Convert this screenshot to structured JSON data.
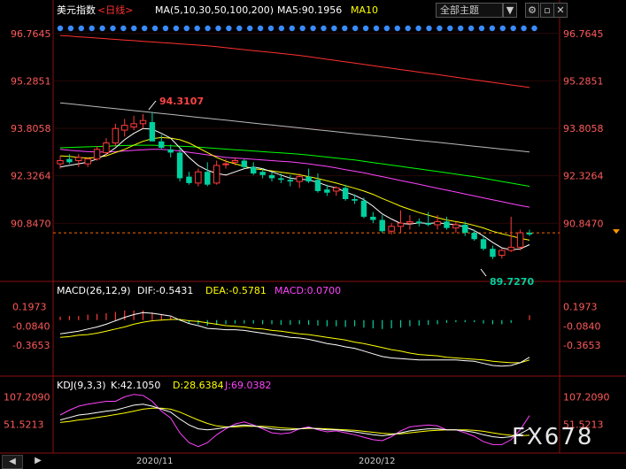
{
  "header": {
    "name": "美元指数",
    "period": "<日线>",
    "ma_label": "MA(5,10,30,50,100,200)",
    "ma5_label": "MA5:90.1956",
    "ma10_label": "MA10",
    "theme_button": "全部主题",
    "theme_arrow": "▼"
  },
  "colors": {
    "up": "#ff3b3b",
    "down": "#00d0a0",
    "price_label": "#ff4444",
    "ma5": "#ffffff",
    "ma10": "#ffff00",
    "ma30": "#ff44ff",
    "ma50": "#00ff00",
    "ma100": "#bbbbbb",
    "ma200": "#ff3030",
    "macd_dif": "#ffffff",
    "macd_dea": "#ffff00",
    "macd_bar": "#ff44ff",
    "kdj_k": "#ffffff",
    "kdj_d": "#ffff00",
    "kdj_j": "#ff44ff"
  },
  "macd_header": {
    "name": "MACD(26,12,9)",
    "dif": "DIF:-0.5431",
    "dea": "DEA:-0.5781",
    "macd": "MACD:0.0700"
  },
  "kdj_header": {
    "name": "KDJ(9,3,3)",
    "k": "K:42.1050",
    "d": "D:28.6384",
    "j": "J:69.0382"
  },
  "annotations": {
    "high": "94.3107",
    "low": "89.7270"
  },
  "watermark": "FX678",
  "footer": {
    "x_ticks": [
      "2020/11",
      "2020/12"
    ]
  },
  "chart_data": {
    "type": "candlestick",
    "price_axis_ticks": [
      "96.7645",
      "95.2851",
      "93.8058",
      "92.3264",
      "90.8470"
    ],
    "macd_axis_ticks": [
      "0.1973",
      "-0.0840",
      "-0.3653"
    ],
    "kdj_axis_ticks": [
      "107.2090",
      "51.5213"
    ],
    "ylim_price": [
      89.2,
      97.2
    ],
    "last_price_line": 90.55,
    "candles": [
      {
        "o": 92.7,
        "h": 92.95,
        "l": 92.55,
        "c": 92.8
      },
      {
        "o": 92.85,
        "h": 93.0,
        "l": 92.7,
        "c": 92.75
      },
      {
        "o": 92.8,
        "h": 93.0,
        "l": 92.6,
        "c": 92.9
      },
      {
        "o": 92.7,
        "h": 92.9,
        "l": 92.6,
        "c": 92.85
      },
      {
        "o": 92.85,
        "h": 93.25,
        "l": 92.8,
        "c": 93.15
      },
      {
        "o": 93.05,
        "h": 93.5,
        "l": 92.95,
        "c": 93.35
      },
      {
        "o": 93.35,
        "h": 93.95,
        "l": 93.25,
        "c": 93.8
      },
      {
        "o": 93.75,
        "h": 94.1,
        "l": 93.55,
        "c": 93.9
      },
      {
        "o": 93.85,
        "h": 94.2,
        "l": 93.75,
        "c": 93.95
      },
      {
        "o": 93.95,
        "h": 94.25,
        "l": 93.8,
        "c": 94.05
      },
      {
        "o": 94.0,
        "h": 94.31,
        "l": 93.7,
        "c": 93.4
      },
      {
        "o": 93.4,
        "h": 93.6,
        "l": 93.15,
        "c": 93.2
      },
      {
        "o": 93.15,
        "h": 93.3,
        "l": 92.9,
        "c": 93.05
      },
      {
        "o": 93.05,
        "h": 93.2,
        "l": 92.15,
        "c": 92.25
      },
      {
        "o": 92.3,
        "h": 92.45,
        "l": 92.05,
        "c": 92.1
      },
      {
        "o": 92.1,
        "h": 92.55,
        "l": 92.0,
        "c": 92.45
      },
      {
        "o": 92.45,
        "h": 92.75,
        "l": 92.0,
        "c": 92.05
      },
      {
        "o": 92.1,
        "h": 92.8,
        "l": 92.05,
        "c": 92.65
      },
      {
        "o": 92.7,
        "h": 92.85,
        "l": 92.55,
        "c": 92.7
      },
      {
        "o": 92.75,
        "h": 92.9,
        "l": 92.65,
        "c": 92.8
      },
      {
        "o": 92.8,
        "h": 92.85,
        "l": 92.55,
        "c": 92.6
      },
      {
        "o": 92.6,
        "h": 92.75,
        "l": 92.35,
        "c": 92.4
      },
      {
        "o": 92.45,
        "h": 92.55,
        "l": 92.25,
        "c": 92.35
      },
      {
        "o": 92.35,
        "h": 92.45,
        "l": 92.15,
        "c": 92.25
      },
      {
        "o": 92.25,
        "h": 92.4,
        "l": 92.1,
        "c": 92.2
      },
      {
        "o": 92.2,
        "h": 92.35,
        "l": 92.0,
        "c": 92.15
      },
      {
        "o": 92.15,
        "h": 92.4,
        "l": 91.95,
        "c": 92.3
      },
      {
        "o": 92.3,
        "h": 92.55,
        "l": 92.1,
        "c": 92.15
      },
      {
        "o": 92.2,
        "h": 92.4,
        "l": 91.8,
        "c": 91.85
      },
      {
        "o": 91.9,
        "h": 92.05,
        "l": 91.7,
        "c": 91.8
      },
      {
        "o": 91.85,
        "h": 92.0,
        "l": 91.7,
        "c": 91.95
      },
      {
        "o": 91.95,
        "h": 92.05,
        "l": 91.55,
        "c": 91.6
      },
      {
        "o": 91.6,
        "h": 91.75,
        "l": 91.45,
        "c": 91.55
      },
      {
        "o": 91.55,
        "h": 91.65,
        "l": 91.0,
        "c": 91.05
      },
      {
        "o": 91.05,
        "h": 91.2,
        "l": 90.85,
        "c": 90.95
      },
      {
        "o": 90.95,
        "h": 91.1,
        "l": 90.55,
        "c": 90.6
      },
      {
        "o": 90.6,
        "h": 90.85,
        "l": 90.5,
        "c": 90.75
      },
      {
        "o": 90.75,
        "h": 91.25,
        "l": 90.55,
        "c": 90.85
      },
      {
        "o": 90.85,
        "h": 91.1,
        "l": 90.65,
        "c": 90.9
      },
      {
        "o": 90.9,
        "h": 91.0,
        "l": 90.75,
        "c": 90.85
      },
      {
        "o": 90.85,
        "h": 91.2,
        "l": 90.75,
        "c": 90.8
      },
      {
        "o": 90.8,
        "h": 91.1,
        "l": 90.65,
        "c": 90.9
      },
      {
        "o": 90.9,
        "h": 91.05,
        "l": 90.65,
        "c": 90.7
      },
      {
        "o": 90.7,
        "h": 90.9,
        "l": 90.55,
        "c": 90.8
      },
      {
        "o": 90.8,
        "h": 90.9,
        "l": 90.45,
        "c": 90.55
      },
      {
        "o": 90.55,
        "h": 90.65,
        "l": 90.3,
        "c": 90.35
      },
      {
        "o": 90.35,
        "h": 90.45,
        "l": 90.0,
        "c": 90.05
      },
      {
        "o": 90.05,
        "h": 90.15,
        "l": 89.73,
        "c": 89.8
      },
      {
        "o": 89.85,
        "h": 90.05,
        "l": 89.75,
        "c": 90.0
      },
      {
        "o": 90.0,
        "h": 91.05,
        "l": 89.95,
        "c": 90.1
      },
      {
        "o": 90.1,
        "h": 90.65,
        "l": 90.0,
        "c": 90.55
      },
      {
        "o": 90.55,
        "h": 90.65,
        "l": 90.45,
        "c": 90.5
      }
    ],
    "ma5": [
      92.6,
      92.65,
      92.7,
      92.75,
      92.85,
      93.0,
      93.2,
      93.45,
      93.65,
      93.8,
      93.78,
      93.65,
      93.5,
      93.2,
      92.9,
      92.65,
      92.5,
      92.4,
      92.35,
      92.45,
      92.55,
      92.6,
      92.55,
      92.45,
      92.35,
      92.25,
      92.22,
      92.2,
      92.12,
      92.02,
      91.95,
      91.82,
      91.72,
      91.58,
      91.38,
      91.14,
      90.98,
      90.84,
      90.82,
      90.86,
      90.84,
      90.86,
      90.83,
      90.8,
      90.73,
      90.62,
      90.45,
      90.25,
      90.08,
      90.02,
      90.05,
      90.18
    ],
    "ma10": [
      92.95,
      92.93,
      92.9,
      92.88,
      92.9,
      92.95,
      93.05,
      93.15,
      93.28,
      93.4,
      93.48,
      93.52,
      93.5,
      93.45,
      93.35,
      93.2,
      93.05,
      92.9,
      92.78,
      92.7,
      92.62,
      92.55,
      92.52,
      92.48,
      92.44,
      92.4,
      92.36,
      92.3,
      92.24,
      92.17,
      92.1,
      92.02,
      91.94,
      91.85,
      91.75,
      91.62,
      91.5,
      91.38,
      91.28,
      91.18,
      91.1,
      91.02,
      90.95,
      90.9,
      90.85,
      90.78,
      90.7,
      90.6,
      90.52,
      90.45,
      90.38,
      90.32
    ],
    "ma30": [
      93.15,
      93.12,
      93.1,
      93.08,
      93.07,
      93.07,
      93.08,
      93.1,
      93.12,
      93.14,
      93.15,
      93.15,
      93.13,
      93.1,
      93.06,
      93.02,
      92.98,
      92.94,
      92.9,
      92.88,
      92.86,
      92.84,
      92.82,
      92.8,
      92.78,
      92.76,
      92.73,
      92.7,
      92.66,
      92.62,
      92.57,
      92.52,
      92.47,
      92.42,
      92.36,
      92.3,
      92.24,
      92.18,
      92.12,
      92.06,
      92.0,
      91.94,
      91.88,
      91.82,
      91.76,
      91.7,
      91.64,
      91.58,
      91.52,
      91.46,
      91.4,
      91.35
    ],
    "ma50": [
      93.2,
      93.21,
      93.22,
      93.23,
      93.24,
      93.25,
      93.26,
      93.27,
      93.28,
      93.28,
      93.28,
      93.27,
      93.26,
      93.25,
      93.24,
      93.22,
      93.2,
      93.18,
      93.16,
      93.14,
      93.12,
      93.1,
      93.08,
      93.06,
      93.04,
      93.02,
      93.0,
      92.97,
      92.94,
      92.91,
      92.88,
      92.85,
      92.82,
      92.78,
      92.74,
      92.7,
      92.66,
      92.62,
      92.58,
      92.54,
      92.5,
      92.46,
      92.42,
      92.38,
      92.34,
      92.3,
      92.25,
      92.2,
      92.15,
      92.1,
      92.05,
      92.0
    ],
    "ma100": [
      94.6,
      94.57,
      94.54,
      94.51,
      94.48,
      94.45,
      94.42,
      94.39,
      94.36,
      94.33,
      94.3,
      94.27,
      94.24,
      94.21,
      94.18,
      94.15,
      94.12,
      94.09,
      94.06,
      94.03,
      94.0,
      93.97,
      93.94,
      93.91,
      93.88,
      93.85,
      93.82,
      93.79,
      93.76,
      93.73,
      93.7,
      93.67,
      93.64,
      93.61,
      93.58,
      93.55,
      93.52,
      93.49,
      93.46,
      93.43,
      93.4,
      93.37,
      93.34,
      93.31,
      93.28,
      93.25,
      93.22,
      93.19,
      93.16,
      93.13,
      93.1,
      93.07
    ],
    "ma200": [
      96.7,
      96.68,
      96.66,
      96.64,
      96.62,
      96.6,
      96.58,
      96.56,
      96.54,
      96.52,
      96.5,
      96.48,
      96.46,
      96.44,
      96.42,
      96.4,
      96.38,
      96.35,
      96.32,
      96.29,
      96.26,
      96.23,
      96.2,
      96.17,
      96.14,
      96.11,
      96.08,
      96.04,
      96.0,
      95.96,
      95.92,
      95.88,
      95.84,
      95.8,
      95.76,
      95.72,
      95.68,
      95.64,
      95.6,
      95.56,
      95.52,
      95.48,
      95.44,
      95.4,
      95.36,
      95.32,
      95.28,
      95.24,
      95.2,
      95.16,
      95.12,
      95.08
    ],
    "macd_dif": [
      -0.2,
      -0.18,
      -0.16,
      -0.13,
      -0.1,
      -0.06,
      -0.01,
      0.04,
      0.08,
      0.11,
      0.1,
      0.08,
      0.06,
      0.0,
      -0.05,
      -0.08,
      -0.12,
      -0.13,
      -0.14,
      -0.14,
      -0.15,
      -0.17,
      -0.19,
      -0.21,
      -0.23,
      -0.25,
      -0.26,
      -0.28,
      -0.31,
      -0.34,
      -0.36,
      -0.39,
      -0.41,
      -0.45,
      -0.49,
      -0.53,
      -0.55,
      -0.56,
      -0.57,
      -0.58,
      -0.58,
      -0.58,
      -0.58,
      -0.58,
      -0.59,
      -0.6,
      -0.63,
      -0.66,
      -0.67,
      -0.66,
      -0.62,
      -0.54
    ],
    "macd_dea": [
      -0.25,
      -0.24,
      -0.22,
      -0.21,
      -0.19,
      -0.16,
      -0.13,
      -0.1,
      -0.06,
      -0.03,
      -0.01,
      0.0,
      0.01,
      0.01,
      -0.01,
      -0.02,
      -0.04,
      -0.06,
      -0.08,
      -0.09,
      -0.1,
      -0.12,
      -0.13,
      -0.15,
      -0.16,
      -0.18,
      -0.2,
      -0.21,
      -0.23,
      -0.25,
      -0.27,
      -0.29,
      -0.32,
      -0.34,
      -0.37,
      -0.4,
      -0.43,
      -0.45,
      -0.48,
      -0.5,
      -0.51,
      -0.52,
      -0.54,
      -0.55,
      -0.56,
      -0.57,
      -0.58,
      -0.6,
      -0.61,
      -0.62,
      -0.62,
      -0.58
    ],
    "macd_hist": [
      0.05,
      0.06,
      0.06,
      0.08,
      0.09,
      0.1,
      0.12,
      0.14,
      0.14,
      0.14,
      0.11,
      0.08,
      0.05,
      -0.01,
      -0.04,
      -0.06,
      -0.08,
      -0.07,
      -0.06,
      -0.05,
      -0.05,
      -0.05,
      -0.06,
      -0.06,
      -0.07,
      -0.07,
      -0.06,
      -0.07,
      -0.08,
      -0.09,
      -0.09,
      -0.1,
      -0.09,
      -0.11,
      -0.12,
      -0.13,
      -0.12,
      -0.11,
      -0.09,
      -0.08,
      -0.07,
      -0.06,
      -0.04,
      -0.03,
      -0.03,
      -0.03,
      -0.05,
      -0.06,
      -0.06,
      -0.04,
      0.0,
      0.07
    ],
    "kdj_k": [
      60,
      65,
      70,
      72,
      75,
      78,
      80,
      85,
      90,
      92,
      88,
      82,
      76,
      62,
      50,
      42,
      40,
      42,
      45,
      48,
      50,
      48,
      45,
      42,
      40,
      40,
      42,
      44,
      42,
      40,
      40,
      38,
      36,
      33,
      30,
      28,
      30,
      34,
      38,
      40,
      42,
      42,
      40,
      40,
      38,
      35,
      30,
      26,
      24,
      26,
      32,
      42
    ],
    "kdj_d": [
      55,
      57,
      60,
      62,
      65,
      68,
      71,
      74,
      78,
      82,
      84,
      84,
      82,
      76,
      68,
      60,
      53,
      48,
      46,
      46,
      47,
      47,
      47,
      46,
      44,
      43,
      42,
      43,
      43,
      42,
      41,
      40,
      39,
      37,
      35,
      33,
      32,
      32,
      34,
      36,
      38,
      39,
      40,
      40,
      40,
      39,
      37,
      34,
      31,
      29,
      28,
      29
    ],
    "kdj_j": [
      70,
      80,
      88,
      92,
      95,
      98,
      98,
      107,
      112,
      110,
      98,
      78,
      64,
      34,
      14,
      6,
      14,
      30,
      42,
      52,
      56,
      50,
      42,
      34,
      32,
      34,
      42,
      46,
      40,
      36,
      38,
      34,
      30,
      25,
      20,
      18,
      26,
      38,
      46,
      48,
      50,
      48,
      40,
      40,
      34,
      27,
      16,
      10,
      10,
      20,
      40,
      69
    ]
  }
}
